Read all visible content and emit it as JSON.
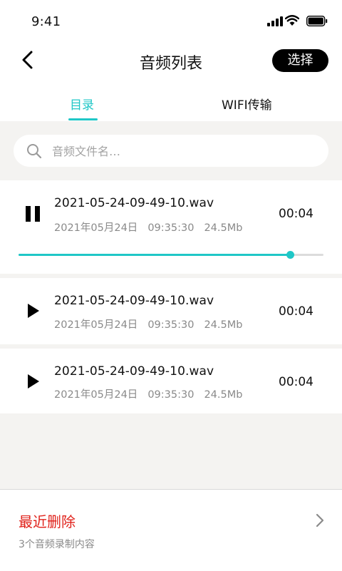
{
  "status_bar": {
    "time": "9:41"
  },
  "header": {
    "title": "音频列表",
    "select_label": "选择"
  },
  "tabs": [
    {
      "label": "目录",
      "active": true
    },
    {
      "label": "WIFI传输",
      "active": false
    }
  ],
  "search": {
    "placeholder": "音频文件名…",
    "value": ""
  },
  "files": [
    {
      "name": "2021-05-24-09-49-10.wav",
      "date": "2021年05月24日",
      "time": "09:35:30",
      "size": "24.5Mb",
      "duration": "00:04",
      "state": "playing",
      "progress": 0.89
    },
    {
      "name": "2021-05-24-09-49-10.wav",
      "date": "2021年05月24日",
      "time": "09:35:30",
      "size": "24.5Mb",
      "duration": "00:04",
      "state": "paused"
    },
    {
      "name": "2021-05-24-09-49-10.wav",
      "date": "2021年05月24日",
      "time": "09:35:30",
      "size": "24.5Mb",
      "duration": "00:04",
      "state": "paused"
    }
  ],
  "recently_deleted": {
    "title": "最近删除",
    "subtitle": "3个音频录制内容"
  },
  "colors": {
    "accent": "#1fc7c7",
    "danger": "#e0221b",
    "text": "#111111",
    "muted": "#8a8a8a",
    "background": "#f4f3f1"
  },
  "icons": {
    "status": [
      "signal-icon",
      "wifi-icon",
      "battery-icon"
    ],
    "back": "chevron-left-icon",
    "search": "search-icon",
    "row_playing": "pause-icon",
    "row_paused": "play-icon",
    "bottom": "chevron-right-icon"
  }
}
